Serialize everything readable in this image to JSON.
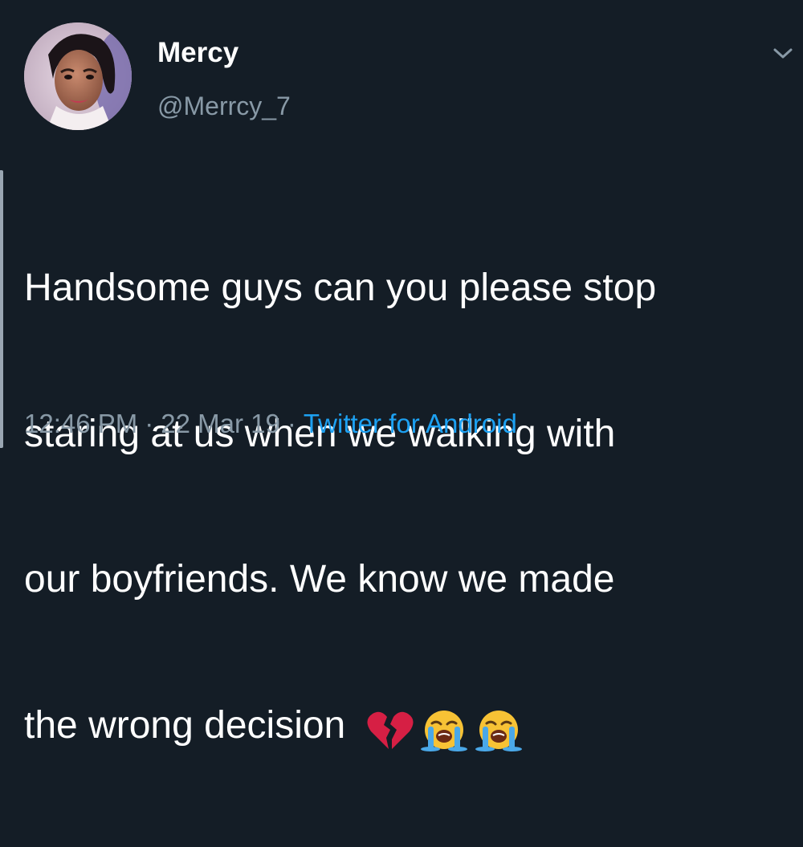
{
  "tweet": {
    "author": {
      "display_name": "Mercy",
      "handle": "@Merrcy_7"
    },
    "text_lines": [
      "Handsome guys can you please stop",
      "staring at us when we walking with",
      "our boyfriends. We know we made",
      "the wrong decision "
    ],
    "emojis": [
      "broken-heart-icon",
      "loudly-crying-face-icon",
      "loudly-crying-face-icon"
    ],
    "time": "12:46 PM",
    "date": "22 Mar 19",
    "separator": "·",
    "source": "Twitter for Android"
  },
  "colors": {
    "background": "#141d26",
    "text": "#ffffff",
    "muted": "#8899a6",
    "link": "#1da1f2"
  }
}
